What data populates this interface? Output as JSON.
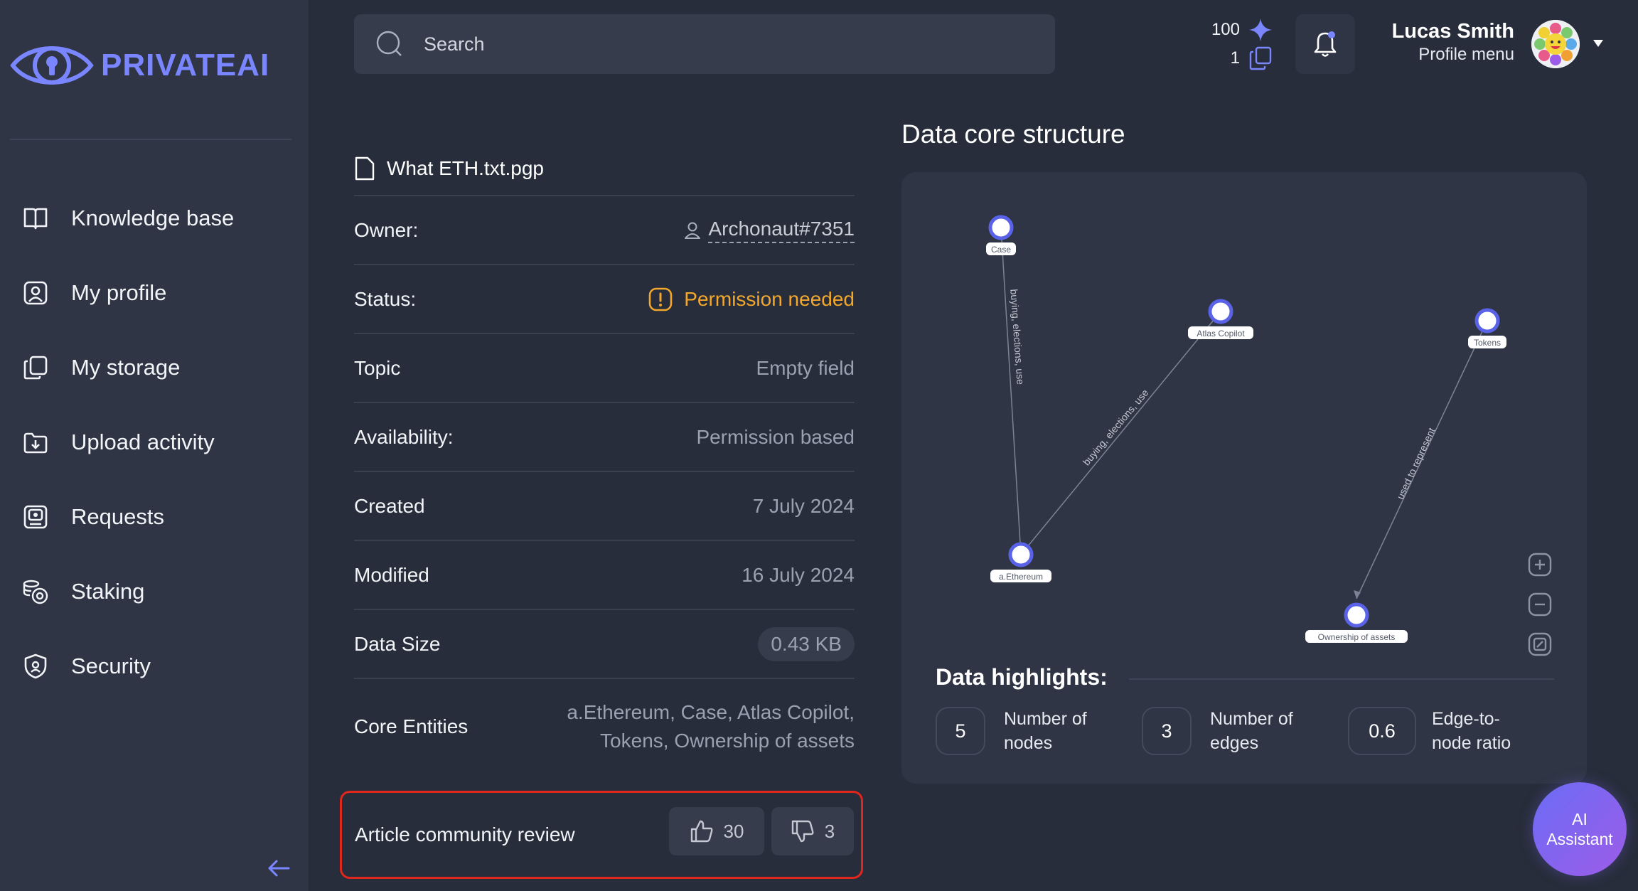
{
  "brand": {
    "name": "PRIVATEAI",
    "accent": "#7a86ff"
  },
  "sidebar": {
    "items": [
      {
        "label": "Knowledge base",
        "icon": "book-icon"
      },
      {
        "label": "My profile",
        "icon": "profile-card-icon"
      },
      {
        "label": "My storage",
        "icon": "storage-icon"
      },
      {
        "label": "Upload activity",
        "icon": "upload-icon"
      },
      {
        "label": "Requests",
        "icon": "requests-icon"
      },
      {
        "label": "Staking",
        "icon": "coins-icon"
      },
      {
        "label": "Security",
        "icon": "shield-icon"
      }
    ],
    "collapse_icon": "arrow-left-icon"
  },
  "header": {
    "search_placeholder": "Search",
    "credits": "100",
    "documents": "1",
    "user_name": "Lucas Smith",
    "user_menu_label": "Profile menu"
  },
  "file": {
    "name": "What ETH.txt.pgp",
    "owner_label": "Owner:",
    "owner": "Archonaut#7351",
    "status_label": "Status:",
    "status": "Permission needed",
    "status_color": "#f3a82b",
    "topic_label": "Topic",
    "topic": "Empty field",
    "availability_label": "Availability:",
    "availability": "Permission based",
    "created_label": "Created",
    "created": "7 July 2024",
    "modified_label": "Modified",
    "modified": "16 July 2024",
    "size_label": "Data Size",
    "size": "0.43 KB",
    "entities_label": "Core Entities",
    "entities_line1": "a.Ethereum, Case, Atlas Copilot,",
    "entities_line2": "Tokens, Ownership of assets"
  },
  "review": {
    "label": "Article community review",
    "likes": "30",
    "dislikes": "3",
    "highlight_color": "#e0261d"
  },
  "graph": {
    "title": "Data core structure",
    "nodes": [
      "Case",
      "Atlas Copilot",
      "Tokens",
      "a.Ethereum",
      "Ownership of assets"
    ],
    "edges": [
      {
        "from": "Case",
        "to": "a.Ethereum",
        "label": "buying, elections, use"
      },
      {
        "from": "Atlas Copilot",
        "to": "a.Ethereum",
        "label": "buying, elections, use"
      },
      {
        "from": "Tokens",
        "to": "Ownership of assets",
        "label": "used to represent"
      }
    ]
  },
  "highlights": {
    "title": "Data highlights:",
    "nodes_value": "5",
    "nodes_label_1": "Number of",
    "nodes_label_2": "nodes",
    "edges_value": "3",
    "edges_label_1": "Number of",
    "edges_label_2": "edges",
    "ratio_value": "0.6",
    "ratio_label_1": "Edge-to-",
    "ratio_label_2": "node ratio"
  },
  "assistant": {
    "line1": "AI",
    "line2": "Assistant"
  }
}
